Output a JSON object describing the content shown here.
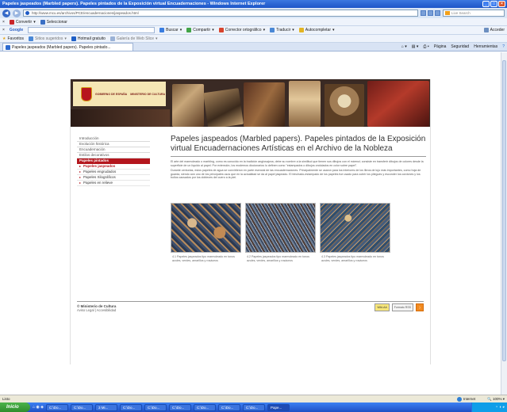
{
  "window": {
    "title": "Papeles jaspeados (Marbled papers). Papeles pintados de la Exposición virtual Encuadernaciones - Windows Internet Explorer"
  },
  "address_bar": {
    "url": "http://www.mcu.es/archivos/PCE/encuadernaciones/jaspeados.html",
    "search_placeholder": "Live Search"
  },
  "toolbar1": {
    "convert": "Convertir",
    "select": "Seleccionar"
  },
  "toolbar2": {
    "google_label": "Google",
    "search": "Buscar",
    "share": "Compartir",
    "spell": "Corrector ortográfico",
    "translate": "Traducir",
    "autofill": "Autocompletar",
    "connect": "Acceder"
  },
  "toolbar3": {
    "favorites": "Favoritos",
    "suggested": "Sitios sugeridos",
    "hotmail": "Hotmail gratuito",
    "gallery": "Galería de Web Slice"
  },
  "tab": {
    "label": "Papeles jaspeados (Marbled papers). Papeles pintado...",
    "tools": [
      "Página",
      "Seguridad",
      "Herramientas"
    ]
  },
  "banner": {
    "ministry": "GOBIERNO DE ESPAÑA",
    "sub": "MINISTERIO DE CULTURA"
  },
  "sidebar": {
    "items": [
      {
        "label": "Introducción",
        "active": false
      },
      {
        "label": "Evolución histórica",
        "active": false
      },
      {
        "label": "Encuadernación",
        "active": false
      },
      {
        "label": "Estilos decorativos",
        "active": false
      },
      {
        "label": "Papeles pintados",
        "active": true
      }
    ],
    "subitems": [
      {
        "label": "Papeles jaspeados",
        "current": true
      },
      {
        "label": "Papeles engrudados",
        "current": false
      },
      {
        "label": "Papeles Xilográficos",
        "current": false
      },
      {
        "label": "Papeles en relieve",
        "current": false
      }
    ]
  },
  "content": {
    "title": "Papeles jaspeados (Marbled papers). Papeles pintados de la Exposición virtual Encuadernaciones Artísticas en el Archivo de la Nobleza",
    "paragraphs": [
      "El arte del marmoleado o marbling, como es conocido en la tradición anglosajona, debe su nombre a la similitud que tienen sus dibujos con el mármol; consiste en transferir dibujos de colores desde la superficie de un líquido al papel. Por extensión, los modernos diccionarios lo definen como \"estampados o dibujos ondulados en color sobre papel\".",
      "Durante centurias, estos papeles de agua se convirtieron en parte esencial de las encuadernaciones. Principalmente se usaron para los interiores de los libros de lujo más importantes, como hoja de guarda, siendo aún uno de los principales usos que en la actualidad se da al papel jaspeado. El trinchado-estampado de los papeles fue usado para cubrir los pliegues y esconder los cordones y los bollos causados por los dobleces del cuero a la piel."
    ],
    "gallery": [
      {
        "caption": "4.1 Papeles jaspeados tipo marmoleado en tonos azules, verdes, amarillos y rosáceos"
      },
      {
        "caption": "4.2 Papeles jaspeados tipo marmoleado en tonos azules, verdes, amarillos y rosáceos"
      },
      {
        "caption": "4.3 Papeles jaspeados tipo marmoleado en tonos azules, verdes, amarillos y rosáceos"
      }
    ]
  },
  "footer": {
    "org": "© Ministerio de Cultura",
    "links": "Aviso Legal | Accesibilidad",
    "badges": [
      "WAI-AA",
      "Formato RSS"
    ]
  },
  "statusbar": {
    "left": "Listo",
    "zone": "Internet",
    "zoom": "100%"
  },
  "taskbar": {
    "start": "Inicio",
    "tasks": [
      "C:\\Do...",
      "C:\\Do...",
      "3 Mi...",
      "C:\\Do...",
      "C:\\Do...",
      "C:\\Do...",
      "C:\\Do...",
      "C:\\Do...",
      "C:\\Do...",
      "Pape..."
    ]
  },
  "colors": {
    "accent": "#b4161d",
    "title_bar": "#1c55c8",
    "taskbar": "#2a5fd6"
  }
}
